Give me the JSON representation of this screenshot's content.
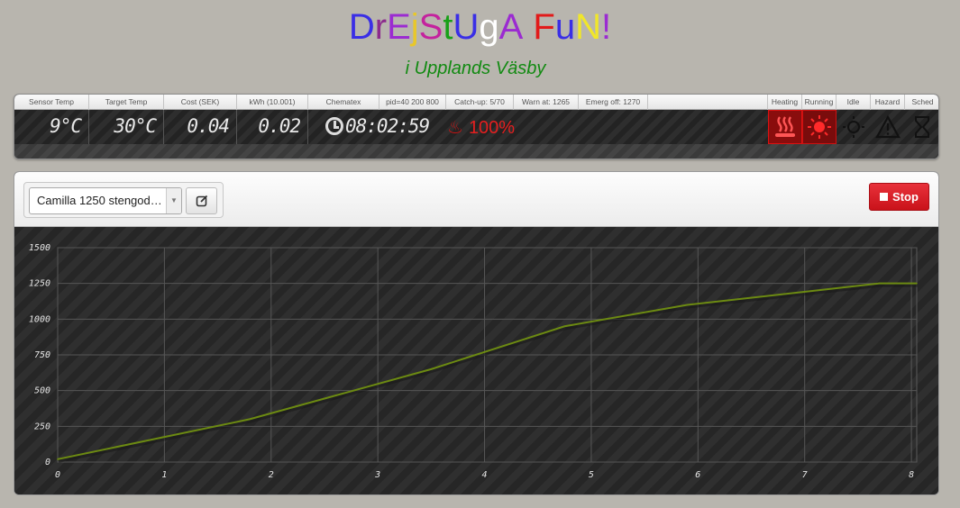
{
  "header": {
    "title_letters": [
      {
        "ch": "D",
        "color": "#3a2ee6"
      },
      {
        "ch": "r",
        "color": "#8c2a8c"
      },
      {
        "ch": "E",
        "color": "#9b2bd1"
      },
      {
        "ch": "j",
        "color": "#e8c72a"
      },
      {
        "ch": "S",
        "color": "#c4229e"
      },
      {
        "ch": "t",
        "color": "#17a017"
      },
      {
        "ch": "U",
        "color": "#3a2ee6"
      },
      {
        "ch": "g",
        "color": "#ffffff"
      },
      {
        "ch": "A",
        "color": "#9b2bd1"
      },
      {
        "ch": " ",
        "color": "#000000"
      },
      {
        "ch": "F",
        "color": "#e21a1a"
      },
      {
        "ch": "u",
        "color": "#3a2ee6"
      },
      {
        "ch": "N",
        "color": "#f0e62a"
      },
      {
        "ch": "!",
        "color": "#9b2bd1"
      }
    ],
    "subtitle": "i Upplands Väsby"
  },
  "status": {
    "headers": [
      "Sensor Temp",
      "Target Temp",
      "Cost (SEK)",
      "kWh (10.001)",
      "Chematex",
      "pid=40 200 800",
      "Catch-up: 5/70",
      "Warn at: 1265",
      "Emerg off: 1270",
      "Heating",
      "Running",
      "Idle",
      "Hazard",
      "Sched"
    ],
    "sensor_temp": "9°C",
    "target_temp": "30°C",
    "cost": "0.04",
    "kwh": "0.02",
    "time": "08:02:59",
    "heat_percent": "100%",
    "states": {
      "heating": {
        "active": true,
        "color": "#c81414"
      },
      "running": {
        "active": true,
        "color": "#e01010"
      },
      "idle": {
        "active": false
      },
      "hazard": {
        "active": false
      },
      "sched": {
        "active": false
      }
    }
  },
  "toolbar": {
    "profile_selected": "Camilla 1250 stengod…",
    "stop_label": "Stop"
  },
  "chart_data": {
    "type": "line",
    "x": [
      0,
      1.8,
      3.5,
      4.75,
      5.9,
      7.7,
      8.05
    ],
    "series": [
      {
        "values": [
          20,
          300,
          650,
          950,
          1100,
          1250,
          1250
        ],
        "color": "#6c8a12"
      }
    ],
    "xticks": [
      0,
      1,
      2,
      3,
      4,
      5,
      6,
      7,
      8
    ],
    "yticks": [
      0,
      250,
      500,
      750,
      1000,
      1250,
      1500
    ],
    "xlim": [
      0,
      8.05
    ],
    "ylim": [
      0,
      1500
    ],
    "grid": true
  }
}
